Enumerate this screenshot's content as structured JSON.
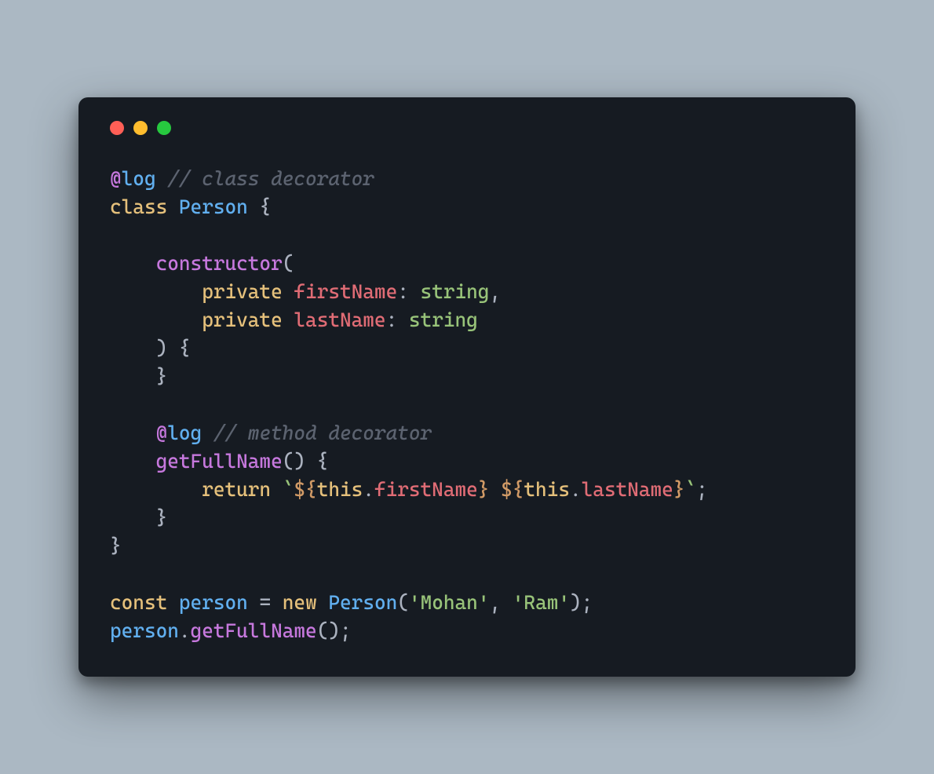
{
  "colors": {
    "page_bg": "#abb8c3",
    "window_bg": "#161b22",
    "dot_red": "#ff5f56",
    "dot_yellow": "#ffbd2e",
    "dot_green": "#27c93f"
  },
  "icons": {
    "close": "close-dot",
    "minimize": "minimize-dot",
    "zoom": "zoom-dot"
  },
  "code": {
    "l1": {
      "at": "@",
      "dec": "log",
      "sp": " ",
      "cm": "// class decorator"
    },
    "l2": {
      "kw": "class",
      "sp": " ",
      "cls": "Person",
      "sp2": " ",
      "p": "{"
    },
    "l3": {
      "blank": ""
    },
    "l4": {
      "ind": "    ",
      "m": "constructor",
      "p": "("
    },
    "l5": {
      "ind": "        ",
      "kw": "private",
      "sp": " ",
      "name": "firstName",
      "p1": ":",
      "sp2": " ",
      "typ": "string",
      "p2": ","
    },
    "l6": {
      "ind": "        ",
      "kw": "private",
      "sp": " ",
      "name": "lastName",
      "p1": ":",
      "sp2": " ",
      "typ": "string"
    },
    "l7": {
      "ind": "    ",
      "p": ") {"
    },
    "l8": {
      "ind": "    ",
      "p": "}"
    },
    "l9": {
      "blank": ""
    },
    "l10": {
      "ind": "    ",
      "at": "@",
      "dec": "log",
      "sp": " ",
      "cm": "// method decorator"
    },
    "l11": {
      "ind": "    ",
      "m": "getFullName",
      "p": "() {"
    },
    "l12": {
      "ind": "        ",
      "kw": "return",
      "sp": " ",
      "bt1": "`",
      "io1": "${",
      "th1": "this",
      "dot1": ".",
      "prop1": "firstName",
      "ic1": "}",
      "mid": " ",
      "io2": "${",
      "th2": "this",
      "dot2": ".",
      "prop2": "lastName",
      "ic2": "}",
      "bt2": "`",
      "semi": ";"
    },
    "l13": {
      "ind": "    ",
      "p": "}"
    },
    "l14": {
      "p": "}"
    },
    "l15": {
      "blank": ""
    },
    "l16": {
      "kw1": "const",
      "sp1": " ",
      "var": "person",
      "sp2": " ",
      "eq": "=",
      "sp3": " ",
      "kw2": "new",
      "sp4": " ",
      "cls": "Person",
      "p1": "(",
      "s1": "'Mohan'",
      "comma": ",",
      "sp5": " ",
      "s2": "'Ram'",
      "p2": ");"
    },
    "l17": {
      "var": "person",
      "dot": ".",
      "m": "getFullName",
      "p": "();"
    }
  }
}
